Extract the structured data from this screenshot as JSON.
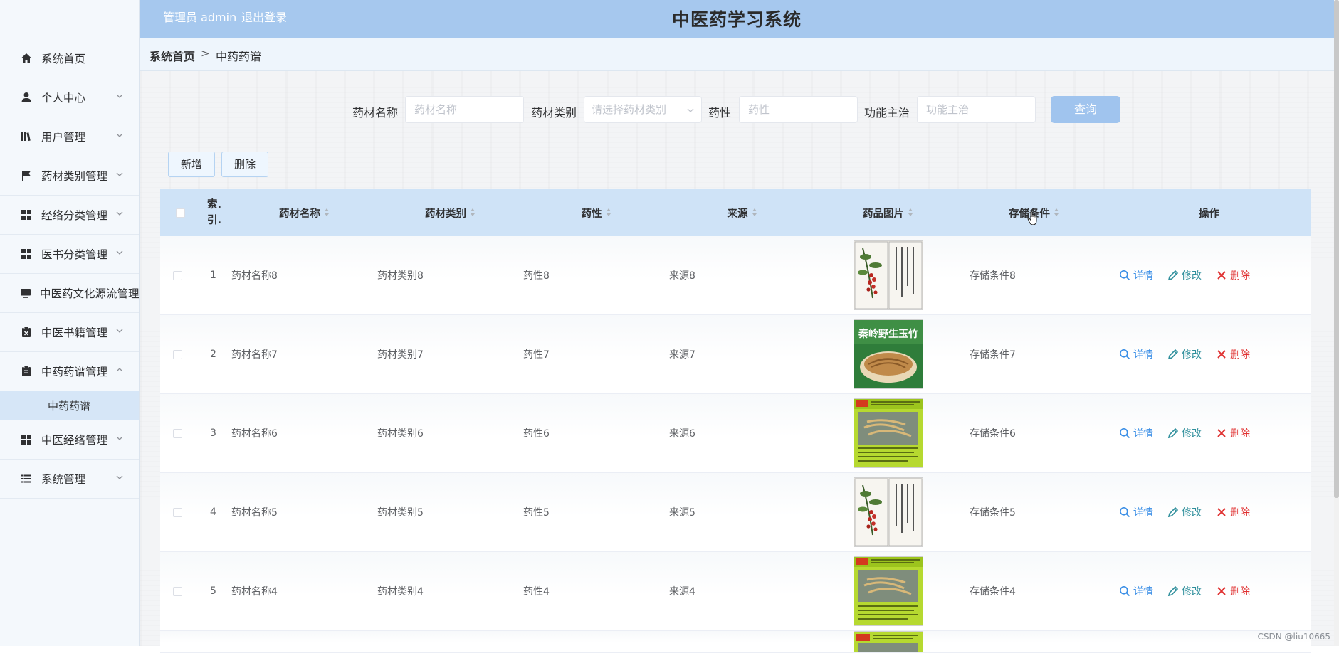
{
  "header": {
    "user": "管理员 admin",
    "logout": "退出登录",
    "title": "中医药学习系统"
  },
  "sidebar": {
    "items": [
      {
        "label": "系统首页",
        "icon": "home-icon",
        "arrow": false
      },
      {
        "label": "个人中心",
        "icon": "user-icon",
        "arrow": true
      },
      {
        "label": "用户管理",
        "icon": "book-icon",
        "arrow": true
      },
      {
        "label": "药材类别管理",
        "icon": "flag-icon",
        "arrow": true
      },
      {
        "label": "经络分类管理",
        "icon": "grid-icon",
        "arrow": true
      },
      {
        "label": "医书分类管理",
        "icon": "grid-icon",
        "arrow": true
      },
      {
        "label": "中医药文化源流管理",
        "icon": "monitor-icon",
        "arrow": false
      },
      {
        "label": "中医书籍管理",
        "icon": "clipboard-x-icon",
        "arrow": true
      },
      {
        "label": "中药药谱管理",
        "icon": "clipboard-icon",
        "arrow": true,
        "open": true
      },
      {
        "label": "中医经络管理",
        "icon": "grid-icon",
        "arrow": true
      },
      {
        "label": "系统管理",
        "icon": "list-icon",
        "arrow": true
      }
    ],
    "sub_item": "中药药谱"
  },
  "breadcrumb": {
    "home": "系统首页",
    "separator": ">",
    "current": "中药药谱"
  },
  "search": {
    "name_label": "药材名称",
    "name_placeholder": "药材名称",
    "category_label": "药材类别",
    "category_placeholder": "请选择药材类别",
    "nature_label": "药性",
    "nature_placeholder": "药性",
    "function_label": "功能主治",
    "function_placeholder": "功能主治",
    "query_button": "查询"
  },
  "actions": {
    "add": "新增",
    "delete": "删除"
  },
  "table": {
    "headers": {
      "index": "索.引.",
      "name": "药材名称",
      "category": "药材类别",
      "nature": "药性",
      "source": "来源",
      "image": "药品图片",
      "storage": "存储条件",
      "ops": "操作"
    },
    "op_labels": {
      "detail": "详情",
      "edit": "修改",
      "delete": "删除"
    },
    "rows": [
      {
        "index": "1",
        "name": "药材名称8",
        "category": "药材类别8",
        "nature": "药性8",
        "source": "来源8",
        "image": "berry-scroll",
        "storage": "存储条件8"
      },
      {
        "index": "2",
        "name": "药材名称7",
        "category": "药材类别7",
        "nature": "药性7",
        "source": "来源7",
        "image": "yuzhu-bowl",
        "storage": "存储条件7",
        "image_caption": "秦岭野生玉竹"
      },
      {
        "index": "3",
        "name": "药材名称6",
        "category": "药材类别6",
        "nature": "药性6",
        "source": "来源6",
        "image": "green-roots",
        "storage": "存储条件6"
      },
      {
        "index": "4",
        "name": "药材名称5",
        "category": "药材类别5",
        "nature": "药性5",
        "source": "来源5",
        "image": "berry-scroll",
        "storage": "存储条件5"
      },
      {
        "index": "5",
        "name": "药材名称4",
        "category": "药材类别4",
        "nature": "药性4",
        "source": "来源4",
        "image": "green-roots",
        "storage": "存储条件4"
      }
    ]
  },
  "watermark": "CSDN @liu10665",
  "colors": {
    "header_bg": "#a6c8ee",
    "table_head_bg": "#cfe3f7",
    "detail": "#3a8ee6",
    "edit": "#2f8f9c",
    "delete": "#e03232"
  }
}
